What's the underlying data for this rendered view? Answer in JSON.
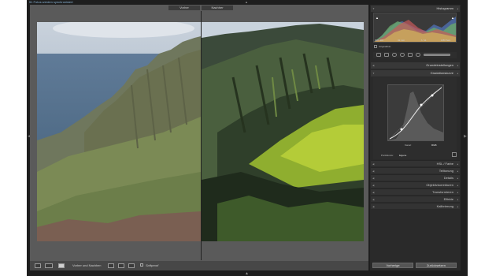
{
  "status_text": "51 Fotos werden synchronisiert",
  "view_labels": {
    "before": "Vorher",
    "after": "Nachher"
  },
  "toolbar": {
    "before_after_label": "Vorher und Nachher:",
    "softproof_label": "Softproof"
  },
  "panel": {
    "histogram_title": "Histogramm",
    "histogram_info": [
      "ISO 400",
      "32 mm",
      "f / 11",
      "1/80 Sek."
    ],
    "original_photo_label": "Originalfoto",
    "basic_title": "Grundeinstellungen",
    "tone_curve_title": "Gradationskurve",
    "tone_regions": [
      "Kanal:",
      "RGB"
    ],
    "point_curve_label": "Punktkurve:",
    "point_curve_value": "Eigene",
    "sections": [
      "HSL / Farbe",
      "Teiltonung",
      "Details",
      "Objektivkorrekturen",
      "Transformieren",
      "Effekte",
      "Kalibrierung"
    ],
    "buttons": {
      "previous": "Vorherige",
      "reset": "Zurücksetzen"
    }
  },
  "icons": [
    "grid-view-icon",
    "loupe-view-icon",
    "before-after-icon",
    "swap-icon",
    "copy-icon",
    "crop-icon",
    "spot-removal-icon",
    "red-eye-icon",
    "graduated-filter-icon",
    "radial-filter-icon",
    "brush-icon"
  ],
  "colors": {
    "accent": "#8ab4d6",
    "panel_bg": "#2a2a2a",
    "header_bg": "#383838"
  }
}
